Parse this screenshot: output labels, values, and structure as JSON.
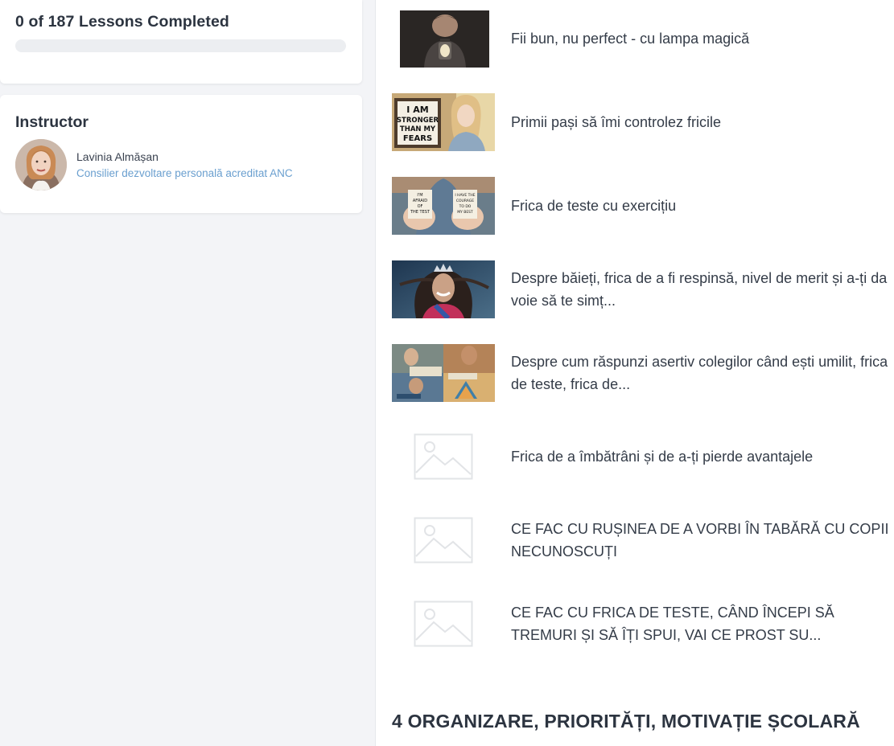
{
  "progress": {
    "title": "0 of 187 Lessons Completed",
    "completed": 0,
    "total": 187,
    "fill_color": "#5b9bd5"
  },
  "instructor": {
    "heading": "Instructor",
    "name": "Lavinia Almășan",
    "role": "Consilier dezvoltare personală acreditat ANC"
  },
  "lessons": [
    {
      "title": "Fii bun, nu perfect - cu lampa magică",
      "thumb": "boy-lamp"
    },
    {
      "title": "Primii pași să îmi controlez fricile",
      "thumb": "girl-sign"
    },
    {
      "title": "Frica de teste cu exercițiu",
      "thumb": "hands-cards"
    },
    {
      "title": "Despre băieți, frica de a fi respinsă, nivel de merit și a-ți da voie să te simț...",
      "thumb": "girl-crown"
    },
    {
      "title": "Despre cum răspunzi asertiv colegilor când ești umilit, frica de teste, frica de...",
      "thumb": "collage"
    },
    {
      "title": "Frica de a îmbătrâni și de a-ți pierde avantajele",
      "thumb": "placeholder-image-icon"
    },
    {
      "title": "CE FAC CU RUȘINEA DE A VORBI ÎN TABĂRĂ CU COPII NECUNOSCUȚI",
      "thumb": "placeholder-image-icon"
    },
    {
      "title": "CE FAC CU FRICA DE TESTE, CÂND ÎNCEPI SĂ TREMURI ȘI SĂ ÎȚI SPUI, VAI CE PROST SU...",
      "thumb": "placeholder-image-icon"
    }
  ],
  "next_section": {
    "title": "4 ORGANIZARE, PRIORITĂȚI, MOTIVAȚIE ȘCOLARĂ"
  },
  "thumb_cards": {
    "girl_sign": "I AM STRONGER THAN MY FEARS",
    "left_card": "I'M AFRAID OF THE TEST",
    "right_card": "I HAVE THE COURAGE TO KEEP GOING TO DO MY BEST"
  }
}
